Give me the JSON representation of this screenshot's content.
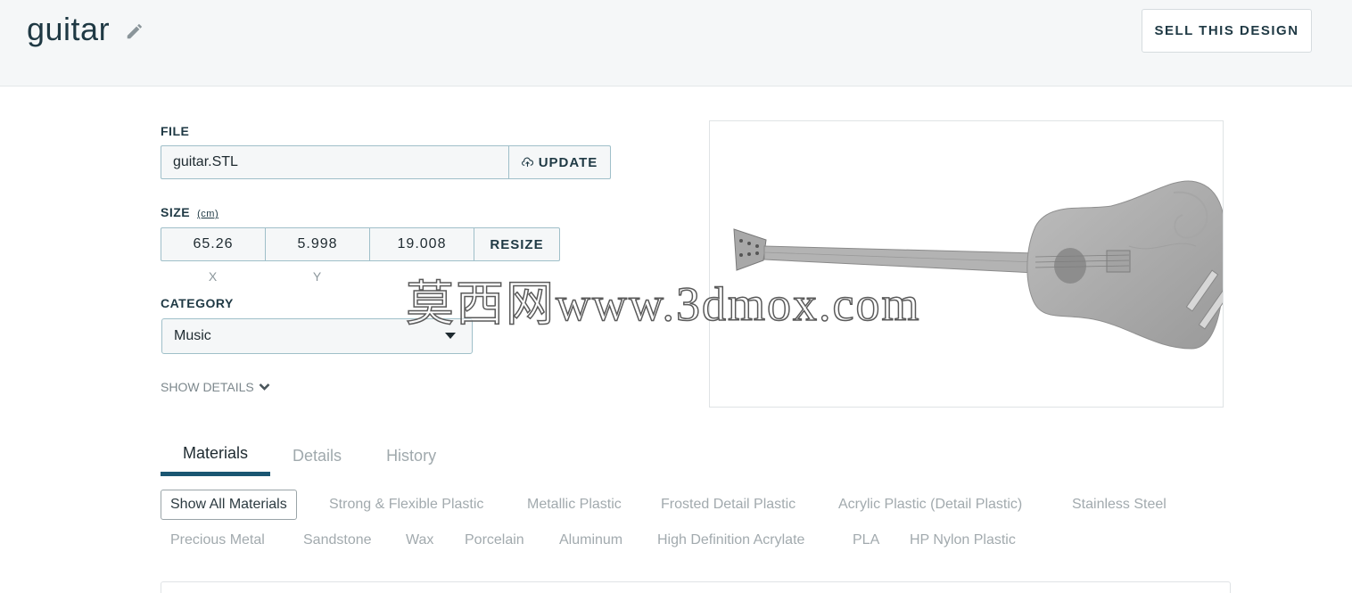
{
  "header": {
    "title": "guitar",
    "sell_label": "SELL THIS DESIGN"
  },
  "file": {
    "label": "FILE",
    "name": "guitar.STL",
    "update_label": "UPDATE"
  },
  "size": {
    "label": "SIZE",
    "unit": "(cm)",
    "x": "65.26",
    "y": "5.998",
    "z": "19.008",
    "resize_label": "RESIZE",
    "axis_x": "X",
    "axis_y": "Y"
  },
  "category": {
    "label": "CATEGORY",
    "value": "Music"
  },
  "show_details": "SHOW DETAILS",
  "tabs": [
    {
      "label": "Materials",
      "active": true
    },
    {
      "label": "Details",
      "active": false
    },
    {
      "label": "History",
      "active": false
    }
  ],
  "materials": [
    "Show All Materials",
    "Strong & Flexible Plastic",
    "Metallic Plastic",
    "Frosted Detail Plastic",
    "Acrylic Plastic (Detail Plastic)",
    "Stainless Steel",
    "Precious Metal",
    "Sandstone",
    "Wax",
    "Porcelain",
    "Aluminum",
    "High Definition Acrylate",
    "PLA",
    "HP Nylon Plastic"
  ],
  "watermark": "莫西网www.3dmox.com",
  "icons": {
    "edit": "pencil-icon",
    "update": "cloud-upload-icon",
    "show_details": "chevron-down-icon",
    "select": "caret-down-icon"
  },
  "colors": {
    "accent": "#1a5672",
    "field_border": "#9fbfc9",
    "header_bg": "#f5f7f8"
  }
}
